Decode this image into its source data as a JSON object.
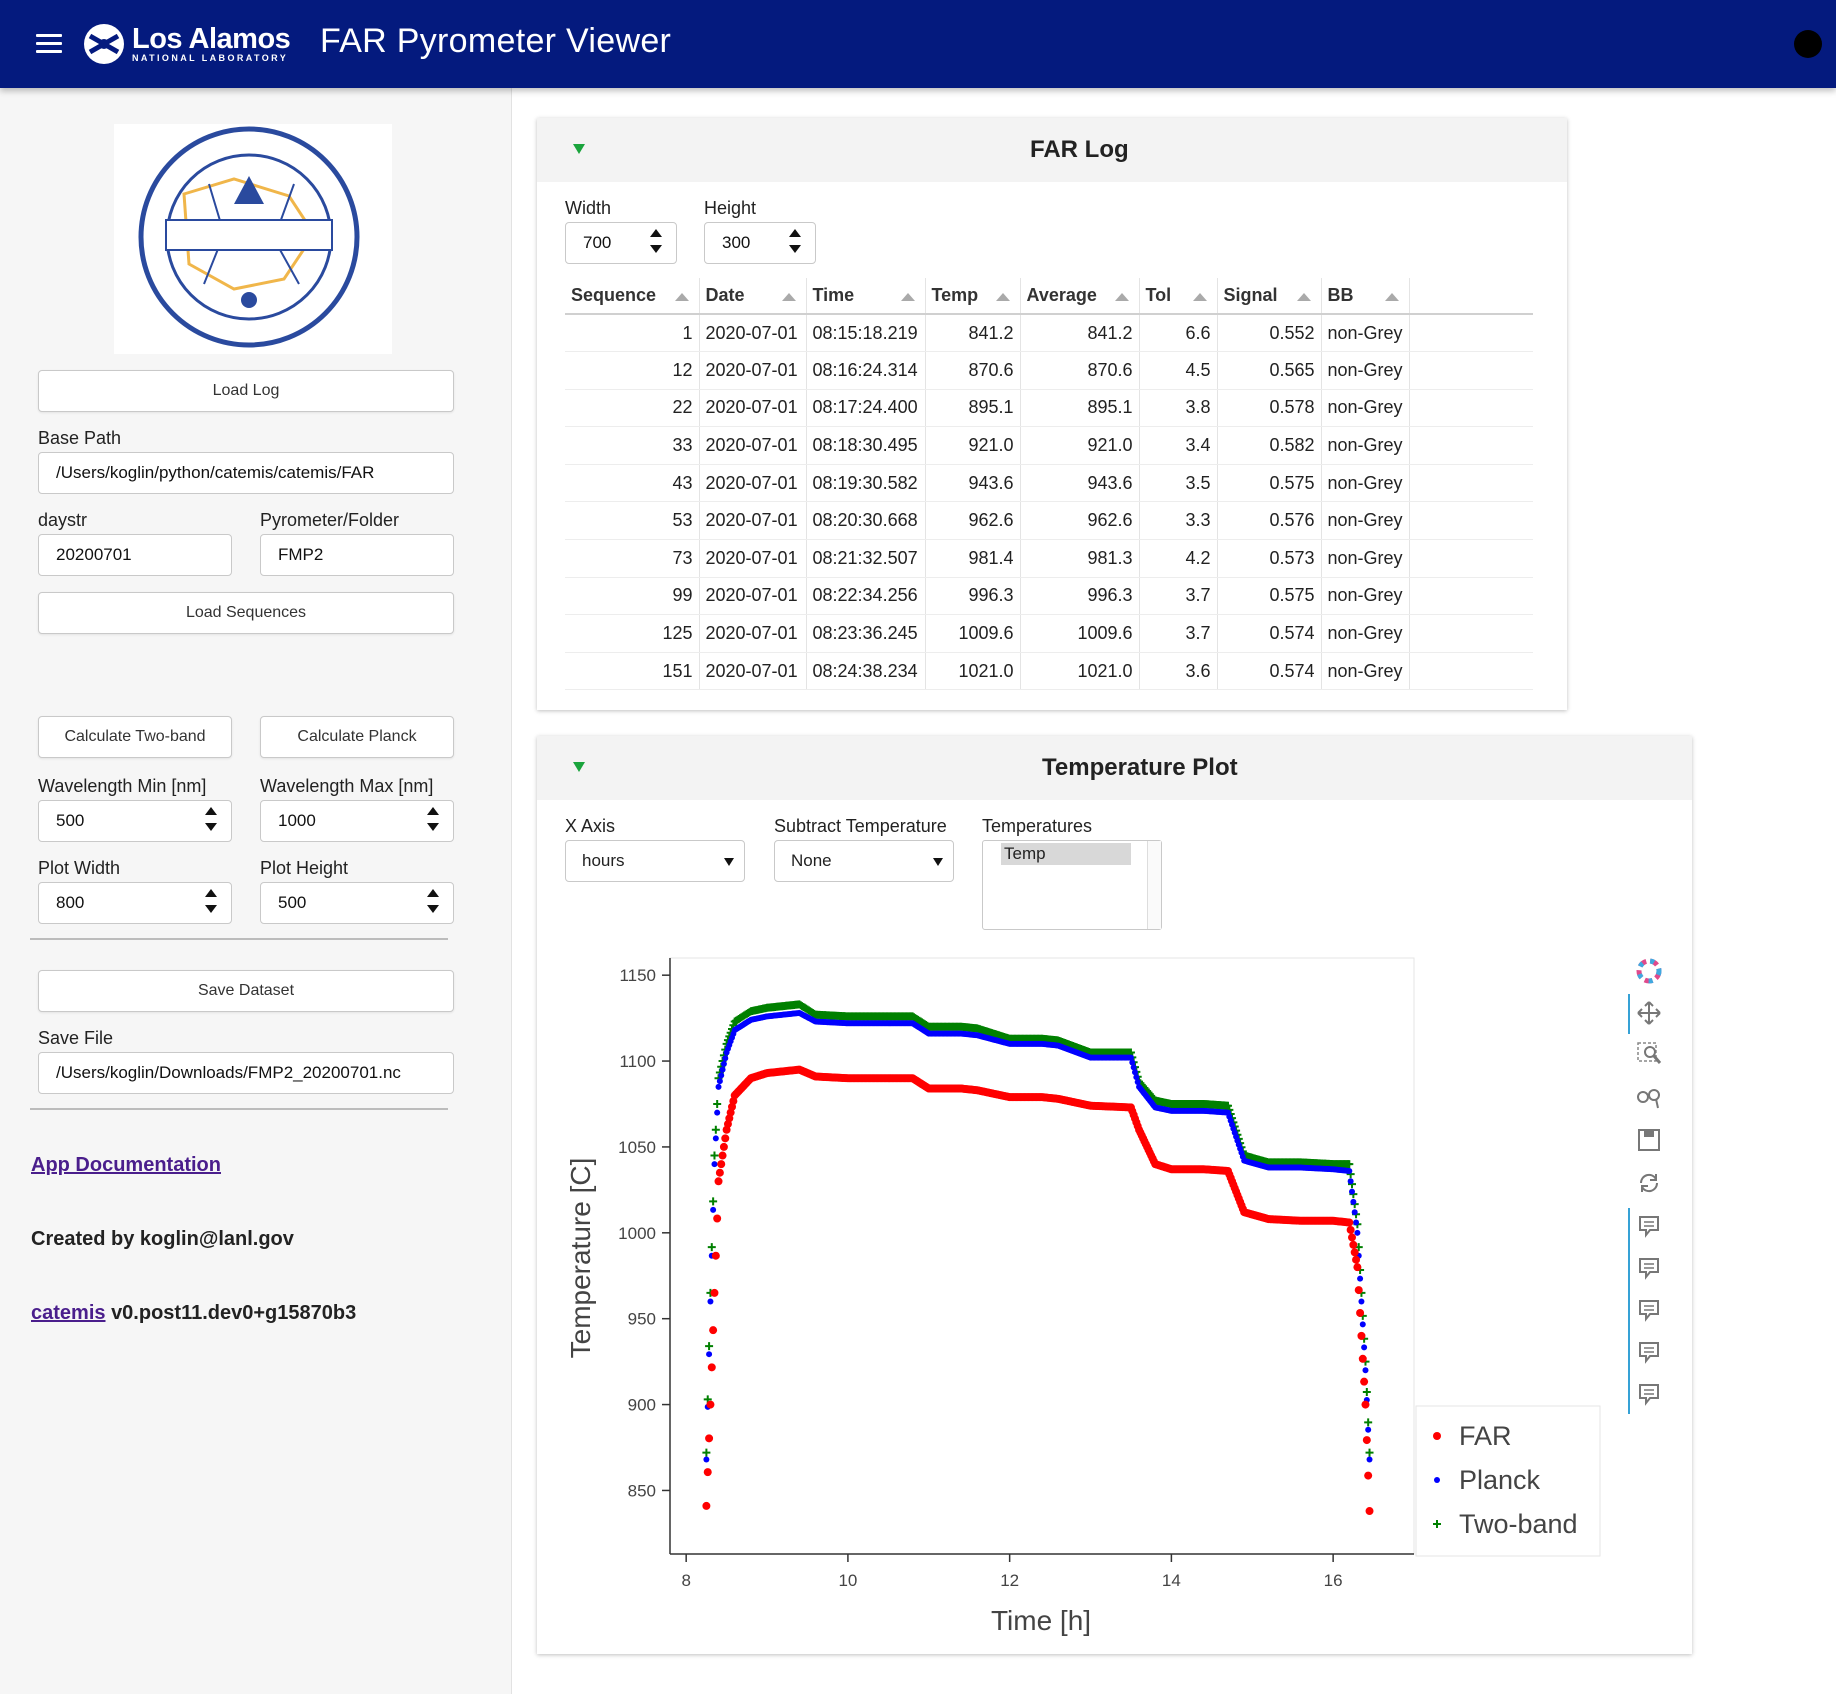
{
  "app": {
    "title": "FAR Pyrometer Viewer",
    "org_name": "Los Alamos",
    "org_sub": "NATIONAL LABORATORY"
  },
  "sidebar": {
    "load_log": "Load Log",
    "base_path_label": "Base Path",
    "base_path": "/Users/koglin/python/catemis/catemis/FAR",
    "daystr_label": "daystr",
    "daystr": "20200701",
    "pyrometer_label": "Pyrometer/Folder",
    "pyrometer": "FMP2",
    "load_sequences": "Load Sequences",
    "calc_twoband": "Calculate Two-band",
    "calc_planck": "Calculate Planck",
    "wl_min_label": "Wavelength Min [nm]",
    "wl_min": "500",
    "wl_max_label": "Wavelength Max [nm]",
    "wl_max": "1000",
    "plot_width_label": "Plot Width",
    "plot_width": "800",
    "plot_height_label": "Plot Height",
    "plot_height": "500",
    "save_dataset": "Save Dataset",
    "save_file_label": "Save File",
    "save_file": "/Users/koglin/Downloads/FMP2_20200701.nc",
    "doc_link": "App Documentation",
    "created_by": "Created by koglin@lanl.gov",
    "pkg_link": "catemis",
    "version": "v0.post11.dev0+g15870b3"
  },
  "far_log": {
    "title": "FAR Log",
    "width_label": "Width",
    "width": "700",
    "height_label": "Height",
    "height": "300",
    "columns": [
      "Sequence",
      "Date",
      "Time",
      "Temp",
      "Average",
      "Tol",
      "Signal",
      "BB"
    ],
    "rows": [
      [
        "1",
        "2020-07-01",
        "08:15:18.219",
        "841.2",
        "841.2",
        "6.6",
        "0.552",
        "non-Grey"
      ],
      [
        "12",
        "2020-07-01",
        "08:16:24.314",
        "870.6",
        "870.6",
        "4.5",
        "0.565",
        "non-Grey"
      ],
      [
        "22",
        "2020-07-01",
        "08:17:24.400",
        "895.1",
        "895.1",
        "3.8",
        "0.578",
        "non-Grey"
      ],
      [
        "33",
        "2020-07-01",
        "08:18:30.495",
        "921.0",
        "921.0",
        "3.4",
        "0.582",
        "non-Grey"
      ],
      [
        "43",
        "2020-07-01",
        "08:19:30.582",
        "943.6",
        "943.6",
        "3.5",
        "0.575",
        "non-Grey"
      ],
      [
        "53",
        "2020-07-01",
        "08:20:30.668",
        "962.6",
        "962.6",
        "3.3",
        "0.576",
        "non-Grey"
      ],
      [
        "73",
        "2020-07-01",
        "08:21:32.507",
        "981.4",
        "981.3",
        "4.2",
        "0.573",
        "non-Grey"
      ],
      [
        "99",
        "2020-07-01",
        "08:22:34.256",
        "996.3",
        "996.3",
        "3.7",
        "0.575",
        "non-Grey"
      ],
      [
        "125",
        "2020-07-01",
        "08:23:36.245",
        "1009.6",
        "1009.6",
        "3.7",
        "0.574",
        "non-Grey"
      ],
      [
        "151",
        "2020-07-01",
        "08:24:38.234",
        "1021.0",
        "1021.0",
        "3.6",
        "0.574",
        "non-Grey"
      ]
    ]
  },
  "temp_plot": {
    "title": "Temperature Plot",
    "xaxis_label": "X Axis",
    "xaxis": "hours",
    "subtract_label": "Subtract Temperature",
    "subtract": "None",
    "temps_label": "Temperatures",
    "temps_selected": "Temp"
  },
  "chart_data": {
    "type": "scatter",
    "xlabel": "Time [h]",
    "ylabel": "Temperature [C]",
    "xlim": [
      7.8,
      17.0
    ],
    "ylim": [
      813,
      1160
    ],
    "xticks": [
      8,
      10,
      12,
      14,
      16
    ],
    "yticks": [
      850,
      900,
      950,
      1000,
      1050,
      1100,
      1150
    ],
    "legend_position": "bottom-right",
    "series": [
      {
        "name": "FAR",
        "color": "#ff0000",
        "marker": "circle",
        "x": [
          8.25,
          8.3,
          8.35,
          8.4,
          8.5,
          8.6,
          8.8,
          9.0,
          9.2,
          9.4,
          9.6,
          10.0,
          10.4,
          10.8,
          11.0,
          11.4,
          11.6,
          12.0,
          12.4,
          12.6,
          13.0,
          13.5,
          13.6,
          13.8,
          14.0,
          14.4,
          14.7,
          14.9,
          15.2,
          15.6,
          16.0,
          16.2,
          16.3,
          16.4,
          16.45
        ],
        "y": [
          841,
          900,
          965,
          1030,
          1060,
          1080,
          1090,
          1093,
          1094,
          1095,
          1091,
          1090,
          1090,
          1090,
          1084,
          1084,
          1083,
          1079,
          1079,
          1078,
          1074,
          1073,
          1060,
          1040,
          1037,
          1037,
          1036,
          1012,
          1008,
          1007,
          1007,
          1006,
          980,
          900,
          838
        ]
      },
      {
        "name": "Planck",
        "color": "#0000ff",
        "marker": "star",
        "x": [
          8.25,
          8.3,
          8.35,
          8.4,
          8.5,
          8.6,
          8.8,
          9.0,
          9.2,
          9.4,
          9.6,
          10.0,
          10.4,
          10.8,
          11.0,
          11.4,
          11.6,
          12.0,
          12.4,
          12.6,
          13.0,
          13.5,
          13.6,
          13.8,
          14.0,
          14.4,
          14.7,
          14.9,
          15.2,
          15.6,
          16.0,
          16.2,
          16.3,
          16.4,
          16.45
        ],
        "y": [
          868,
          960,
          1040,
          1085,
          1105,
          1118,
          1124,
          1126,
          1127,
          1128,
          1123,
          1122,
          1122,
          1122,
          1116,
          1116,
          1115,
          1110,
          1110,
          1109,
          1102,
          1102,
          1085,
          1073,
          1071,
          1071,
          1070,
          1042,
          1038,
          1038,
          1037,
          1036,
          1000,
          920,
          868
        ]
      },
      {
        "name": "Two-band",
        "color": "#008000",
        "marker": "cross",
        "x": [
          8.25,
          8.3,
          8.35,
          8.4,
          8.5,
          8.6,
          8.8,
          9.0,
          9.2,
          9.4,
          9.6,
          10.0,
          10.4,
          10.8,
          11.0,
          11.4,
          11.6,
          12.0,
          12.4,
          12.6,
          13.0,
          13.5,
          13.6,
          13.8,
          14.0,
          14.4,
          14.7,
          14.9,
          15.2,
          15.6,
          16.0,
          16.2,
          16.3,
          16.4,
          16.45
        ],
        "y": [
          872,
          965,
          1045,
          1090,
          1110,
          1123,
          1129,
          1131,
          1132,
          1133,
          1127,
          1126,
          1126,
          1126,
          1120,
          1120,
          1119,
          1113,
          1113,
          1112,
          1105,
          1105,
          1088,
          1077,
          1075,
          1075,
          1074,
          1045,
          1041,
          1041,
          1040,
          1040,
          1005,
          925,
          872
        ]
      }
    ]
  }
}
